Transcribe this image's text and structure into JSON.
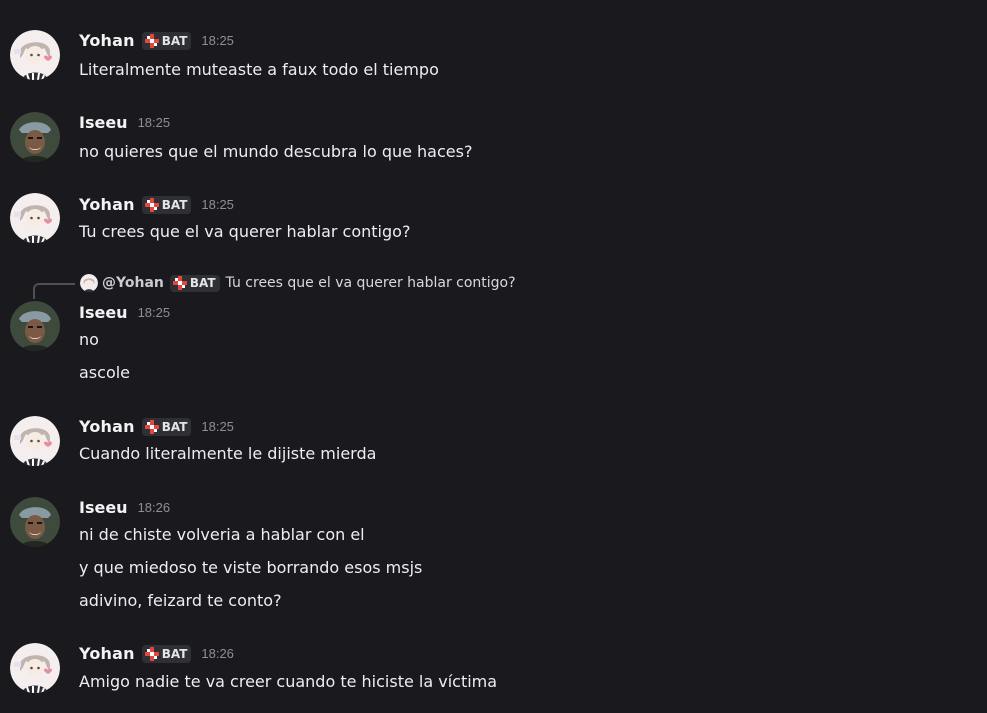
{
  "colors": {
    "background": "#1a1a1e",
    "username": "#f2f3f5",
    "message_text": "#eceef0",
    "timestamp": "#8d8f96",
    "tag_background": "#2f3036",
    "tag_icon_red": "#e0473d"
  },
  "messages": [
    {
      "user": "Yohan",
      "avatar": "yohan-avatar-icon",
      "tag": "BAT",
      "time": "18:25",
      "lines": [
        "Literalmente muteaste a faux todo el tiempo"
      ]
    },
    {
      "user": "Iseeu",
      "avatar": "iseeu-avatar-icon",
      "time": "18:25",
      "lines": [
        "no quieres que el mundo descubra lo que haces?"
      ]
    },
    {
      "user": "Yohan",
      "avatar": "yohan-avatar-icon",
      "tag": "BAT",
      "time": "18:25",
      "lines": [
        "Tu crees que el va querer hablar contigo?"
      ]
    },
    {
      "user": "Iseeu",
      "avatar": "iseeu-avatar-icon",
      "time": "18:25",
      "reply": {
        "name": "@Yohan",
        "tag": "BAT",
        "text": "Tu crees que el va querer hablar contigo?"
      },
      "lines": [
        "no",
        "ascole"
      ]
    },
    {
      "user": "Yohan",
      "avatar": "yohan-avatar-icon",
      "tag": "BAT",
      "time": "18:25",
      "lines": [
        "Cuando literalmente le dijiste mierda"
      ]
    },
    {
      "user": "Iseeu",
      "avatar": "iseeu-avatar-icon",
      "time": "18:26",
      "lines": [
        "ni de chiste volveria a hablar con el",
        "y que miedoso te viste borrando esos msjs",
        "adivino, feizard te conto?"
      ]
    },
    {
      "user": "Yohan",
      "avatar": "yohan-avatar-icon",
      "tag": "BAT",
      "time": "18:26",
      "lines": [
        "Amigo nadie te va creer cuando te hiciste la víctima"
      ]
    }
  ]
}
